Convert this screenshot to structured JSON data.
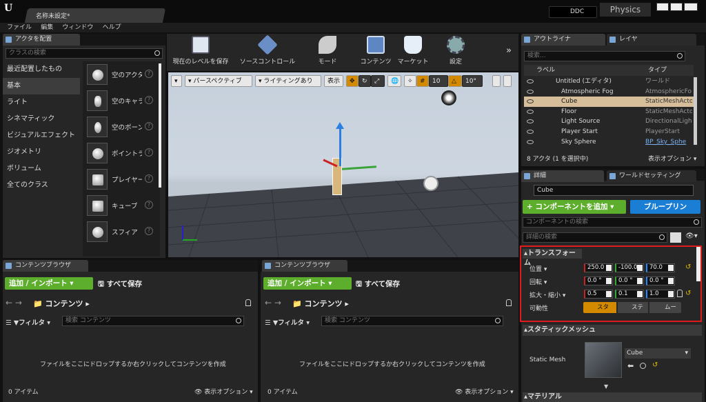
{
  "window": {
    "title": "名称未設定*",
    "ddc": "DDC",
    "project": "Physics"
  },
  "menu": [
    "ファイル",
    "編集",
    "ウィンドウ",
    "ヘルプ"
  ],
  "place_panel": {
    "tab": "アクタを配置",
    "search_placeholder": "クラスの検索",
    "categories": [
      "最近配置したもの",
      "基本",
      "ライト",
      "シネマティック",
      "ビジュアルエフェクト",
      "ジオメトリ",
      "ボリューム",
      "全てのクラス"
    ],
    "selected_category": "基本",
    "actors": [
      "空のアクタ",
      "空のキャラ",
      "空のポーン",
      "ポイントラ",
      "プレイヤー",
      "キューブ",
      "スフィア"
    ]
  },
  "toolbar": {
    "buttons": [
      "現在のレベルを保存",
      "ソースコントロール",
      "モード",
      "コンテンツ",
      "マーケット",
      "設定"
    ]
  },
  "viewport": {
    "perspective": "パースペクティブ",
    "lighting": "ライティングあり",
    "show": "表示",
    "grid_snap": "10",
    "rot_snap": "10°"
  },
  "outliner": {
    "tabs": [
      "アウトライナ",
      "レイヤ"
    ],
    "search_placeholder": "検索...",
    "col_label": "ラベル",
    "col_type": "タイプ",
    "rows": [
      {
        "name": "Untitled (エディタ)",
        "type": "ワールド"
      },
      {
        "name": "Atmospheric Fog",
        "type": "AtmosphericFo"
      },
      {
        "name": "Cube",
        "type": "StaticMeshActo"
      },
      {
        "name": "Floor",
        "type": "StaticMeshActo"
      },
      {
        "name": "Light Source",
        "type": "DirectionalLigh"
      },
      {
        "name": "Player Start",
        "type": "PlayerStart"
      },
      {
        "name": "Sky Sphere",
        "type": "BP_Sky_Sphe"
      }
    ],
    "selected_row": "Cube",
    "status": "8 アクタ (1 を選択中)",
    "view_options": "表示オプション"
  },
  "details": {
    "tabs": [
      "詳細",
      "ワールドセッティング"
    ],
    "name_value": "Cube",
    "add_component": "+ コンポーネントを追加",
    "blueprint": "ブループリン",
    "component_search": "コンポーネントの検索",
    "details_search": "詳細の検索",
    "transform_header": "トランスフォーム",
    "location_label": "位置",
    "rotation_label": "回転",
    "scale_label": "拡大・縮小",
    "mobility_label": "可動性",
    "location": [
      "250.0",
      "-100.0",
      "70.0"
    ],
    "rotation": [
      "0.0 °",
      "0.0 °",
      "0.0 °"
    ],
    "scale": [
      "0.5",
      "0.1",
      "1.0"
    ],
    "mobility": [
      "スタ",
      "ステ",
      "ムー"
    ],
    "static_mesh_header": "スタティックメッシュ",
    "static_mesh_label": "Static Mesh",
    "static_mesh_value": "Cube",
    "material_header": "マテリアル"
  },
  "content_browsers": [
    {
      "tab": "コンテンツブラウザ",
      "add": "追加 / インポート",
      "save_all": "すべて保存",
      "path": "コンテンツ",
      "filter": "フィルタ",
      "search_placeholder": "検索 コンテンツ",
      "drop_hint": "ファイルをここにドロップするか右クリックしてコンテンツを作成",
      "items": "0 アイテム",
      "view_options": "表示オプション"
    },
    {
      "tab": "コンテンツブラウザ",
      "add": "追加 / インポート",
      "save_all": "すべて保存",
      "path": "コンテンツ",
      "filter": "フィルタ",
      "search_placeholder": "検索 コンテンツ",
      "drop_hint": "ファイルをここにドロップするか右クリックしてコンテンツを作成",
      "items": "0 アイテム",
      "view_options": "表示オプション"
    }
  ],
  "colors": {
    "accent_orange": "#d48a00",
    "green_button": "#5eae2e",
    "blue_button": "#1a7fd4",
    "highlight_red": "#e01b1b"
  }
}
